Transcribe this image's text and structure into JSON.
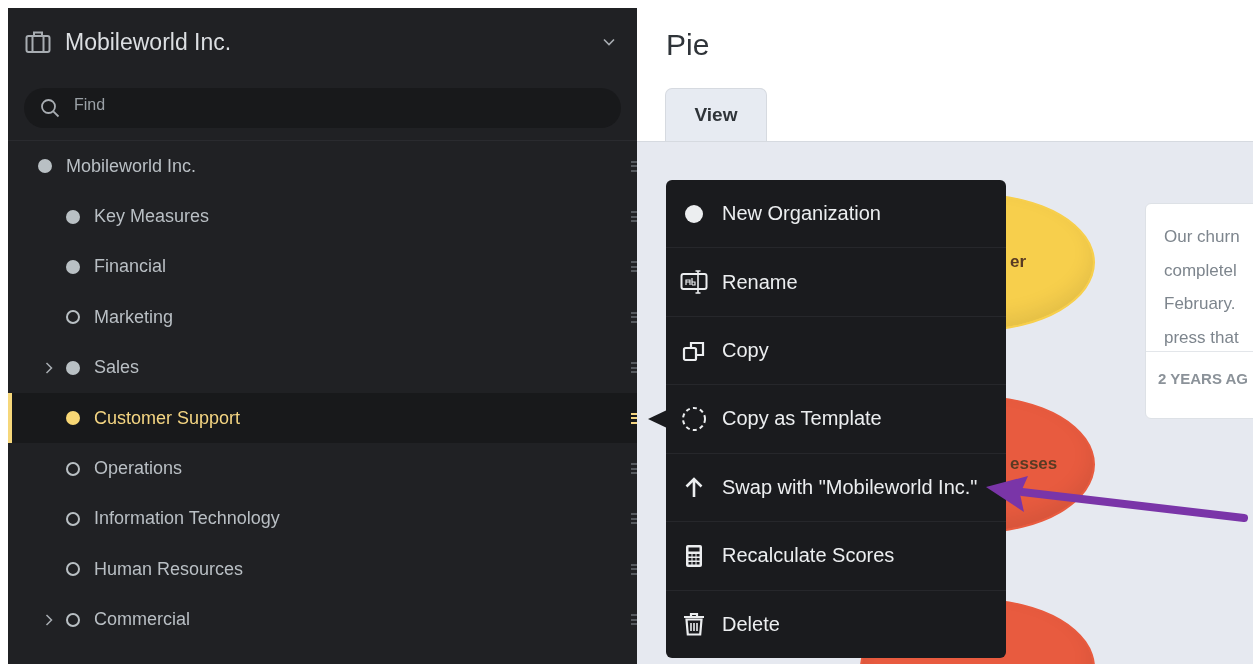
{
  "sidebar": {
    "org_title": "Mobileworld Inc.",
    "search": {
      "placeholder": "Find"
    },
    "tree": [
      {
        "label": "Mobileworld Inc.",
        "filled": true,
        "selected": false,
        "children": [
          {
            "label": "Key Measures",
            "filled": true,
            "selected": false
          },
          {
            "label": "Financial",
            "filled": true,
            "selected": false
          },
          {
            "label": "Marketing",
            "filled": false,
            "selected": false
          },
          {
            "label": "Sales",
            "filled": true,
            "selected": false,
            "expanded": false,
            "has_children": true
          },
          {
            "label": "Customer Support",
            "filled": true,
            "selected": true
          },
          {
            "label": "Operations",
            "filled": false,
            "selected": false
          },
          {
            "label": "Information Technology",
            "filled": false,
            "selected": false
          },
          {
            "label": "Human Resources",
            "filled": false,
            "selected": false
          },
          {
            "label": "Commercial",
            "filled": false,
            "selected": false,
            "expanded": false,
            "has_children": true
          }
        ]
      }
    ]
  },
  "page": {
    "title": "Pie",
    "tabs": [
      {
        "label": "View",
        "selected": true
      }
    ]
  },
  "canvas": {
    "nodes": [
      {
        "label": "er",
        "color": "#f9cf45"
      },
      {
        "label": "esses",
        "color": "#ee5a3c"
      },
      {
        "color": "#ee5a3c"
      }
    ],
    "card": {
      "lines": [
        "Our churn",
        "completel",
        "February.",
        "press that"
      ],
      "footer": "2 YEARS AG"
    }
  },
  "context_menu": [
    {
      "kind": "organization",
      "label": "New Organization"
    },
    {
      "kind": "rename",
      "label": "Rename"
    },
    {
      "kind": "copy",
      "label": "Copy"
    },
    {
      "kind": "template",
      "label": "Copy as Template"
    },
    {
      "kind": "swap",
      "label": "Swap with \"Mobileworld Inc.\""
    },
    {
      "kind": "recalculate",
      "label": "Recalculate Scores"
    },
    {
      "kind": "delete",
      "label": "Delete"
    }
  ]
}
